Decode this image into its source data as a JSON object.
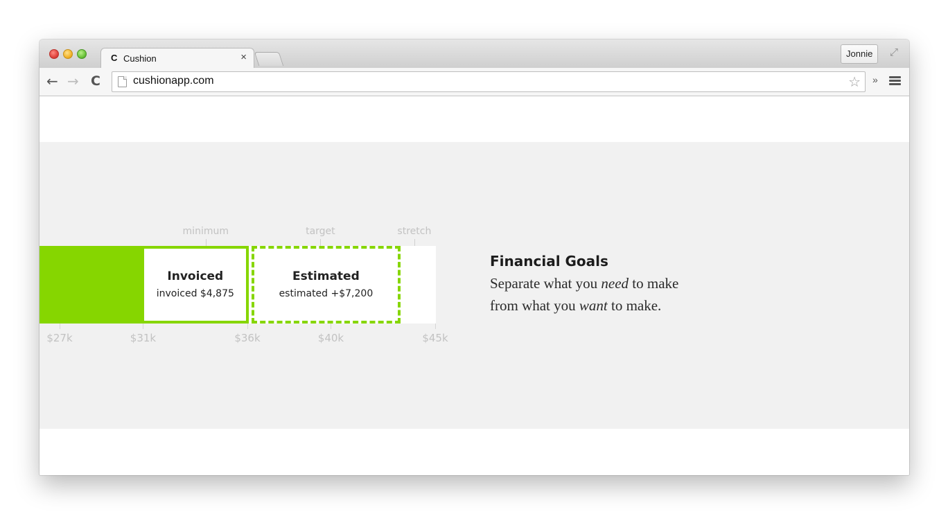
{
  "browser": {
    "tab_favicon": "C",
    "tab_title": "Cushion",
    "tab_close": "×",
    "profile_name": "Jonnie",
    "url": "cushionapp.com",
    "back_icon": "←",
    "forward_icon": "→",
    "reload_icon": "C",
    "star_icon": "☆",
    "overflow_icon": "»",
    "fullscreen_icon": "⤢"
  },
  "colors": {
    "accent_green": "#86d600",
    "band_gray": "#f1f1f1",
    "tick_gray": "#c2c2c2"
  },
  "chart_data": {
    "type": "bar",
    "orientation": "horizontal-stacked-goal-bar",
    "x_ticks": [
      "$27k",
      "$31k",
      "$36k",
      "$40k",
      "$45k"
    ],
    "x_tick_values": [
      27000,
      31000,
      36000,
      40000,
      45000
    ],
    "goal_labels": [
      "minimum",
      "target",
      "stretch"
    ],
    "goal_values": [
      34000,
      39500,
      44000
    ],
    "segments": [
      {
        "name": "",
        "style": "solid",
        "from": 25800,
        "to": 31000
      },
      {
        "name": "Invoiced",
        "style": "outlined",
        "from": 31000,
        "to": 35875,
        "label": "invoiced $4,875"
      },
      {
        "name": "Estimated",
        "style": "dashed",
        "from": 36000,
        "to": 43200,
        "label": "estimated +$7,200"
      }
    ],
    "xlim": [
      25800,
      45000
    ]
  },
  "content": {
    "heading": "Financial Goals",
    "line1_a": "Separate what you ",
    "line1_em": "need",
    "line1_b": " to make",
    "line2_a": "from what you ",
    "line2_em": "want",
    "line2_b": " to make."
  }
}
